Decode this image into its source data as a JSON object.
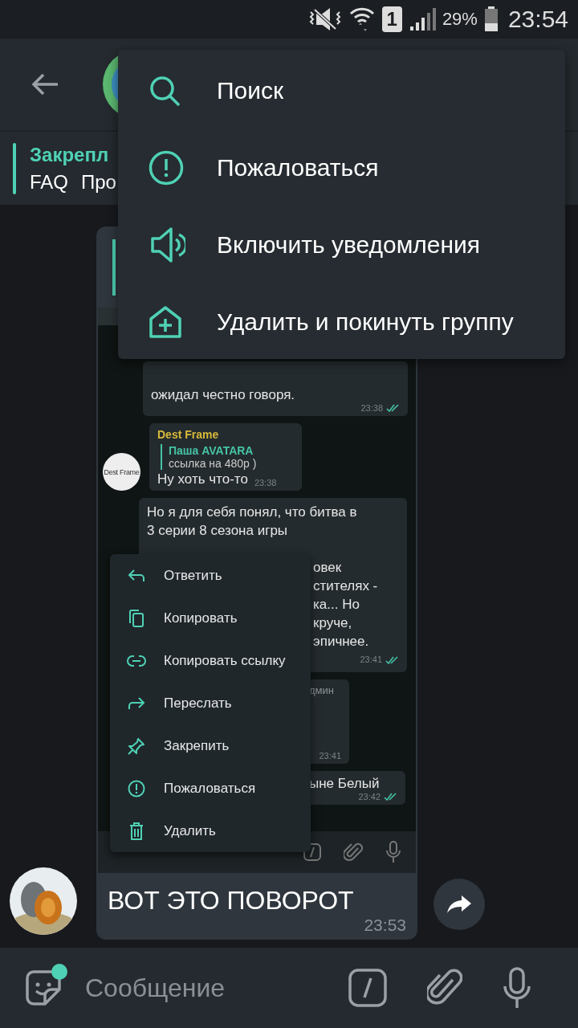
{
  "status_bar": {
    "sim": "1",
    "battery": "29%",
    "time": "23:54"
  },
  "pinned": {
    "title": "Закрепл",
    "text": "FAQ",
    "text_2": "Про"
  },
  "top_menu": [
    {
      "kind": "search",
      "label": "Поиск"
    },
    {
      "kind": "report",
      "label": "Пожаловаться"
    },
    {
      "kind": "sound",
      "label": "Включить уведомления"
    },
    {
      "kind": "leave",
      "label": "Удалить и покинуть группу"
    }
  ],
  "message": {
    "time": "23:53",
    "text": "ВОТ ЭТО ПОВОРОТ"
  },
  "screenshot": {
    "messages": [
      {
        "kind": "wide",
        "lines": [
          "ожидал честно говоря."
        ],
        "time": "23:38",
        "read": true
      },
      {
        "kind": "reply",
        "avatar": "Dest Frame",
        "author": "Dest Frame",
        "quote_author": "Паша AVATARA",
        "quote_text": "ссылка на 480р )",
        "lines": [
          "Ну хоть что-то"
        ],
        "time": "23:38",
        "read": false
      },
      {
        "kind": "long",
        "lines": [
          "Но я для себя понял, что битва в",
          "3 серии 8 сезона игры"
        ],
        "tail_lines": [
          "овек",
          "стителях -",
          "ка... Но",
          "круче,",
          "эпичнее."
        ],
        "time": "23:41",
        "read": true
      },
      {
        "kind": "media",
        "lines": [
          "дмин"
        ],
        "time": "23:41",
        "read": false
      },
      {
        "kind": "short",
        "lines": [
          "ыне Белый"
        ],
        "time": "23:42",
        "read": true
      }
    ]
  },
  "context_menu": [
    {
      "kind": "reply",
      "label": "Ответить"
    },
    {
      "kind": "copy",
      "label": "Копировать"
    },
    {
      "kind": "link",
      "label": "Копировать ссылку"
    },
    {
      "kind": "forward",
      "label": "Переслать"
    },
    {
      "kind": "pin",
      "label": "Закрепить"
    },
    {
      "kind": "report",
      "label": "Пожаловаться"
    },
    {
      "kind": "delete",
      "label": "Удалить"
    }
  ],
  "composer": {
    "placeholder": "Сообщение",
    "sticker_badge": true
  }
}
